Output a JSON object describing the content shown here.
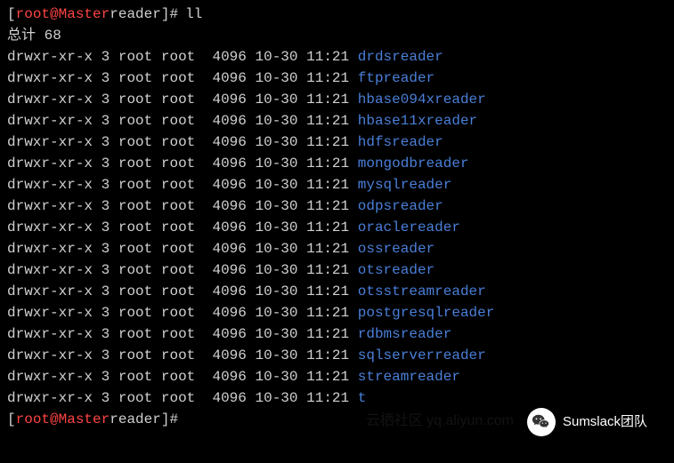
{
  "prompt": {
    "open_bracket": "[",
    "user_host": "root@Master",
    "path": " reader",
    "close_bracket": "]",
    "prompt_char": "#",
    "command": "ll"
  },
  "total": {
    "label": "总计",
    "value": "68"
  },
  "files": [
    {
      "perms": "drwxr-xr-x",
      "links": "3",
      "owner": "root",
      "group": "root",
      "size": "4096",
      "date": "10-30",
      "time": "11:21",
      "name": "drdsreader"
    },
    {
      "perms": "drwxr-xr-x",
      "links": "3",
      "owner": "root",
      "group": "root",
      "size": "4096",
      "date": "10-30",
      "time": "11:21",
      "name": "ftpreader"
    },
    {
      "perms": "drwxr-xr-x",
      "links": "3",
      "owner": "root",
      "group": "root",
      "size": "4096",
      "date": "10-30",
      "time": "11:21",
      "name": "hbase094xreader"
    },
    {
      "perms": "drwxr-xr-x",
      "links": "3",
      "owner": "root",
      "group": "root",
      "size": "4096",
      "date": "10-30",
      "time": "11:21",
      "name": "hbase11xreader"
    },
    {
      "perms": "drwxr-xr-x",
      "links": "3",
      "owner": "root",
      "group": "root",
      "size": "4096",
      "date": "10-30",
      "time": "11:21",
      "name": "hdfsreader"
    },
    {
      "perms": "drwxr-xr-x",
      "links": "3",
      "owner": "root",
      "group": "root",
      "size": "4096",
      "date": "10-30",
      "time": "11:21",
      "name": "mongodbreader"
    },
    {
      "perms": "drwxr-xr-x",
      "links": "3",
      "owner": "root",
      "group": "root",
      "size": "4096",
      "date": "10-30",
      "time": "11:21",
      "name": "mysqlreader"
    },
    {
      "perms": "drwxr-xr-x",
      "links": "3",
      "owner": "root",
      "group": "root",
      "size": "4096",
      "date": "10-30",
      "time": "11:21",
      "name": "odpsreader"
    },
    {
      "perms": "drwxr-xr-x",
      "links": "3",
      "owner": "root",
      "group": "root",
      "size": "4096",
      "date": "10-30",
      "time": "11:21",
      "name": "oraclereader"
    },
    {
      "perms": "drwxr-xr-x",
      "links": "3",
      "owner": "root",
      "group": "root",
      "size": "4096",
      "date": "10-30",
      "time": "11:21",
      "name": "ossreader"
    },
    {
      "perms": "drwxr-xr-x",
      "links": "3",
      "owner": "root",
      "group": "root",
      "size": "4096",
      "date": "10-30",
      "time": "11:21",
      "name": "otsreader"
    },
    {
      "perms": "drwxr-xr-x",
      "links": "3",
      "owner": "root",
      "group": "root",
      "size": "4096",
      "date": "10-30",
      "time": "11:21",
      "name": "otsstreamreader"
    },
    {
      "perms": "drwxr-xr-x",
      "links": "3",
      "owner": "root",
      "group": "root",
      "size": "4096",
      "date": "10-30",
      "time": "11:21",
      "name": "postgresqlreader"
    },
    {
      "perms": "drwxr-xr-x",
      "links": "3",
      "owner": "root",
      "group": "root",
      "size": "4096",
      "date": "10-30",
      "time": "11:21",
      "name": "rdbmsreader"
    },
    {
      "perms": "drwxr-xr-x",
      "links": "3",
      "owner": "root",
      "group": "root",
      "size": "4096",
      "date": "10-30",
      "time": "11:21",
      "name": "sqlserverreader"
    },
    {
      "perms": "drwxr-xr-x",
      "links": "3",
      "owner": "root",
      "group": "root",
      "size": "4096",
      "date": "10-30",
      "time": "11:21",
      "name": "streamreader"
    },
    {
      "perms": "drwxr-xr-x",
      "links": "3",
      "owner": "root",
      "group": "root",
      "size": "4096",
      "date": "10-30",
      "time": "11:21",
      "name": "t"
    }
  ],
  "end_prompt": {
    "open_bracket": "[",
    "user_host": "root@Master",
    "path": " reader",
    "close_bracket": "]",
    "prompt_char": "#"
  },
  "watermark": {
    "faint_text": "云栖社区 yq.aliyun.com",
    "badge_text": "Sumslack团队"
  }
}
